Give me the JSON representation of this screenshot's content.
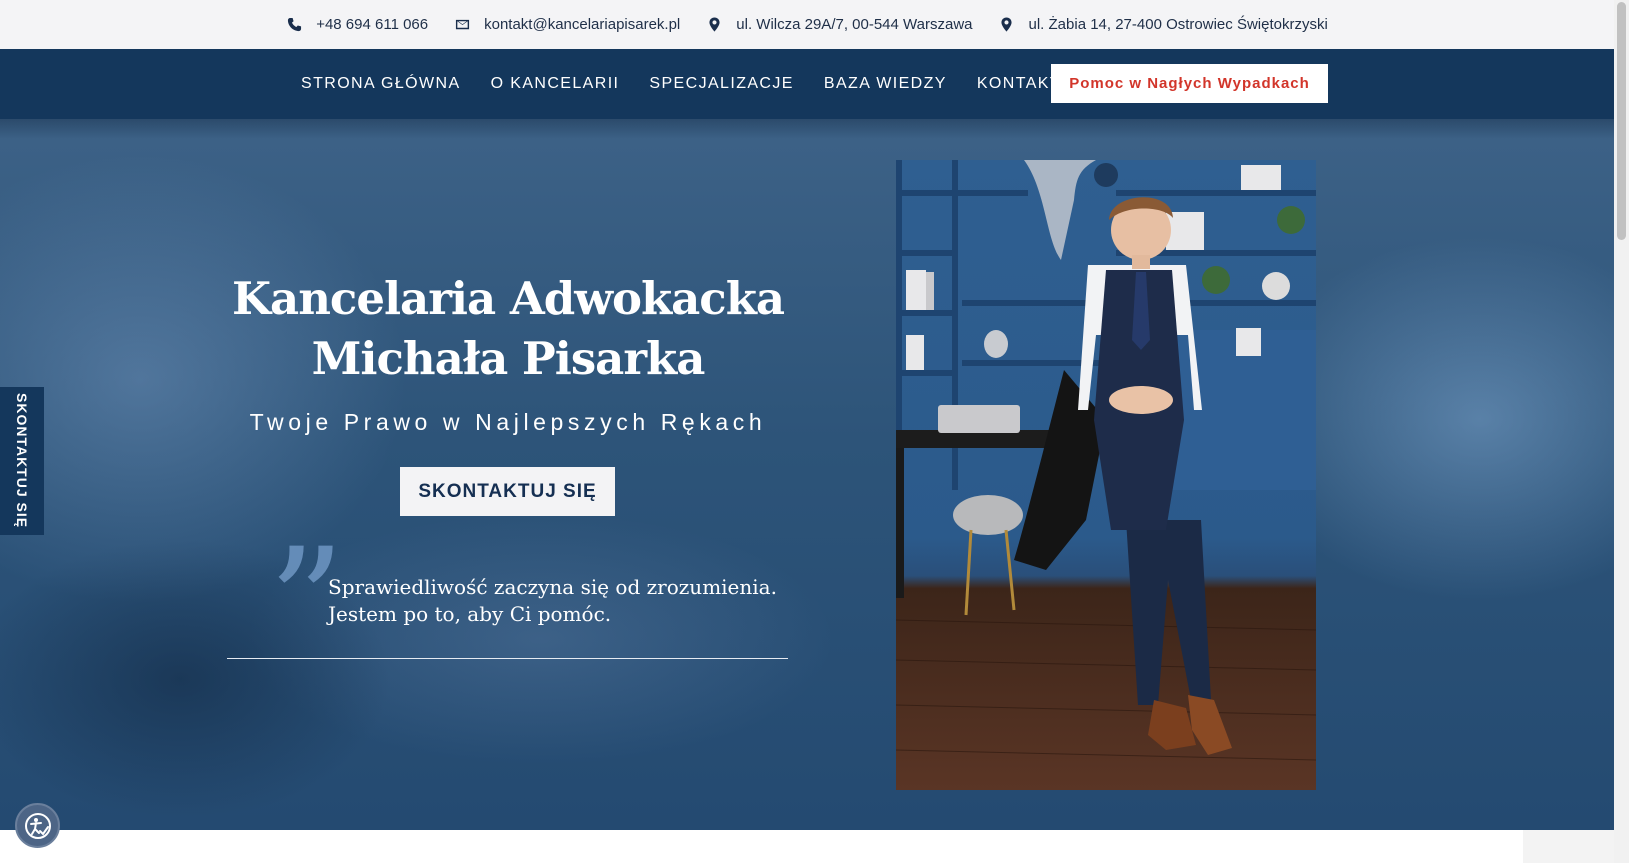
{
  "topbar": {
    "phone": "+48 694 611 066",
    "email": "kontakt@kancelariapisarek.pl",
    "address1": "ul. Wilcza 29A/7, 00-544 Warszawa",
    "address2": "ul. Żabia 14, 27-400 Ostrowiec Świętokrzyski"
  },
  "nav": {
    "items": [
      {
        "label": "STRONA GŁÓWNA"
      },
      {
        "label": "O KANCELARII"
      },
      {
        "label": "SPECJALIZACJE"
      },
      {
        "label": "BAZA WIEDZY"
      },
      {
        "label": "KONTAKT"
      }
    ],
    "cta": "Pomoc w Nagłych Wypadkach"
  },
  "hero": {
    "title_line1": "Kancelaria Adwokacka",
    "title_line2": "Michała Pisarka",
    "subtitle": "Twoje Prawo w Najlepszych Rękach",
    "button": "SKONTAKTUJ SIĘ",
    "quote_line1": "Sprawiedliwość zaczyna się od zrozumienia.",
    "quote_line2": "Jestem po to, aby Ci pomóc."
  },
  "sidetab": {
    "label": "SKONTAKTUJ SIĘ"
  },
  "colors": {
    "navy": "#14375c",
    "accent_red": "#d2352a",
    "hero_blue": "#2d5479"
  },
  "icons": [
    "phone-icon",
    "envelope-icon",
    "map-pin-icon",
    "accessibility-icon",
    "quote-mark-icon"
  ]
}
